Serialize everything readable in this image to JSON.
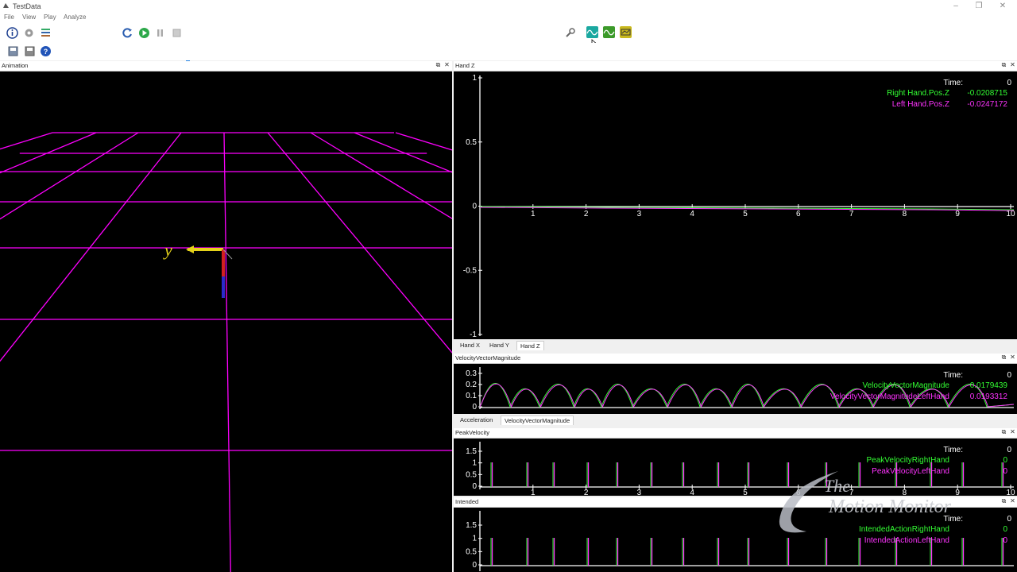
{
  "window": {
    "title": "TestData",
    "controls": [
      "–",
      "❐",
      "✕"
    ]
  },
  "menu": [
    "File",
    "View",
    "Play",
    "Analyze"
  ],
  "toolbar": {
    "icons_row1": [
      "info-icon",
      "gear-icon",
      "channels-icon",
      "reset-icon",
      "play-icon",
      "pause-icon",
      "stop-icon",
      "wrench-icon",
      "graph-cyan-icon",
      "graph-green-icon",
      "graph-yellow-icon"
    ],
    "icons_row2": [
      "open-icon",
      "save-icon",
      "help-icon"
    ]
  },
  "animation": {
    "title": "Animation",
    "grid_color": "#ff00ff",
    "axis_label_y": "y"
  },
  "panel_hand_z": {
    "title": "Hand Z",
    "y_ticks": [
      "1",
      "0.5",
      "0",
      "-0.5",
      "-1"
    ],
    "x_ticks": [
      "1",
      "2",
      "3",
      "4",
      "5",
      "6",
      "7",
      "8",
      "9",
      "10"
    ],
    "legend": {
      "time_label": "Time:",
      "time_value": "0",
      "entries": [
        {
          "name": "Right Hand.Pos.Z",
          "value": "-0.0208715",
          "color": "#33ff33"
        },
        {
          "name": "Left Hand.Pos.Z",
          "value": "-0.0247172",
          "color": "#ff33ff"
        }
      ]
    },
    "tabs": [
      "Hand X",
      "Hand Y",
      "Hand Z"
    ],
    "active_tab": "Hand Z"
  },
  "panel_velocity": {
    "title": "VelocityVectorMagnitude",
    "y_ticks": [
      "0.3",
      "0.2",
      "0.1",
      "0"
    ],
    "legend": {
      "time_label": "Time:",
      "time_value": "0",
      "entries": [
        {
          "name": "VelocityVectorMagnitude",
          "value": "0.0179439",
          "color": "#33ff33"
        },
        {
          "name": "VelocityVectorMagnitudeLeftHand",
          "value": "0.0193312",
          "color": "#ff33ff"
        }
      ]
    },
    "tabs": [
      "Acceleration",
      "VelocityVectorMagnitude"
    ],
    "active_tab": "VelocityVectorMagnitude"
  },
  "panel_peak": {
    "title": "PeakVelocity",
    "y_ticks": [
      "1.5",
      "1",
      "0.5",
      "0"
    ],
    "x_ticks": [
      "1",
      "2",
      "3",
      "4",
      "5",
      "6",
      "7",
      "8",
      "9",
      "10"
    ],
    "legend": {
      "time_label": "Time:",
      "time_value": "0",
      "entries": [
        {
          "name": "PeakVelocityRightHand",
          "value": "0",
          "color": "#33ff33"
        },
        {
          "name": "PeakVelocityLeftHand",
          "value": "0",
          "color": "#ff33ff"
        }
      ]
    }
  },
  "panel_intended": {
    "title": "Intended",
    "y_ticks": [
      "1.5",
      "1",
      "0.5",
      "0"
    ],
    "legend": {
      "time_label": "Time:",
      "time_value": "0",
      "entries": [
        {
          "name": "IntendedActionRightHand",
          "value": "0",
          "color": "#33ff33"
        },
        {
          "name": "IntendedActionLeftHand",
          "value": "0",
          "color": "#ff33ff"
        }
      ]
    }
  },
  "watermark": {
    "line1": "The",
    "line2": "Motion Monitor"
  }
}
